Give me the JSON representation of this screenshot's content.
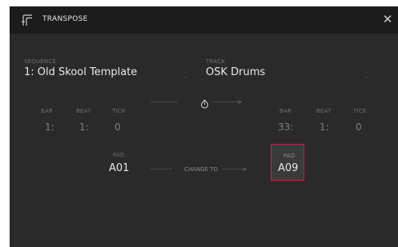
{
  "dialog": {
    "title": "TRANSPOSE",
    "close_glyph": "✕"
  },
  "sequence": {
    "label": "SEQUENCE",
    "value": "1: Old Skool Template"
  },
  "track": {
    "label": "TRACK",
    "value": "OSK Drums"
  },
  "start": {
    "bar_label": "BAR",
    "beat_label": "BEAT",
    "tick_label": "TICK",
    "bar": "1:",
    "beat": "1:",
    "tick": "0"
  },
  "end": {
    "bar_label": "BAR",
    "beat_label": "BEAT",
    "tick_label": "TICK",
    "bar": "33:",
    "beat": "1:",
    "tick": "0"
  },
  "time_connector": {
    "left": "···············",
    "icon": "stopwatch-icon",
    "right": "··············>"
  },
  "pad_from": {
    "label": "PAD",
    "value": "A01"
  },
  "pad_to": {
    "label": "PAD",
    "value": "A09"
  },
  "change_connector": {
    "left": "············",
    "text": "CHANGE TO",
    "right": "···········>"
  },
  "colors": {
    "accent": "#b02a47",
    "background": "#2a2a2a",
    "titlebar": "#1c1c1c"
  }
}
